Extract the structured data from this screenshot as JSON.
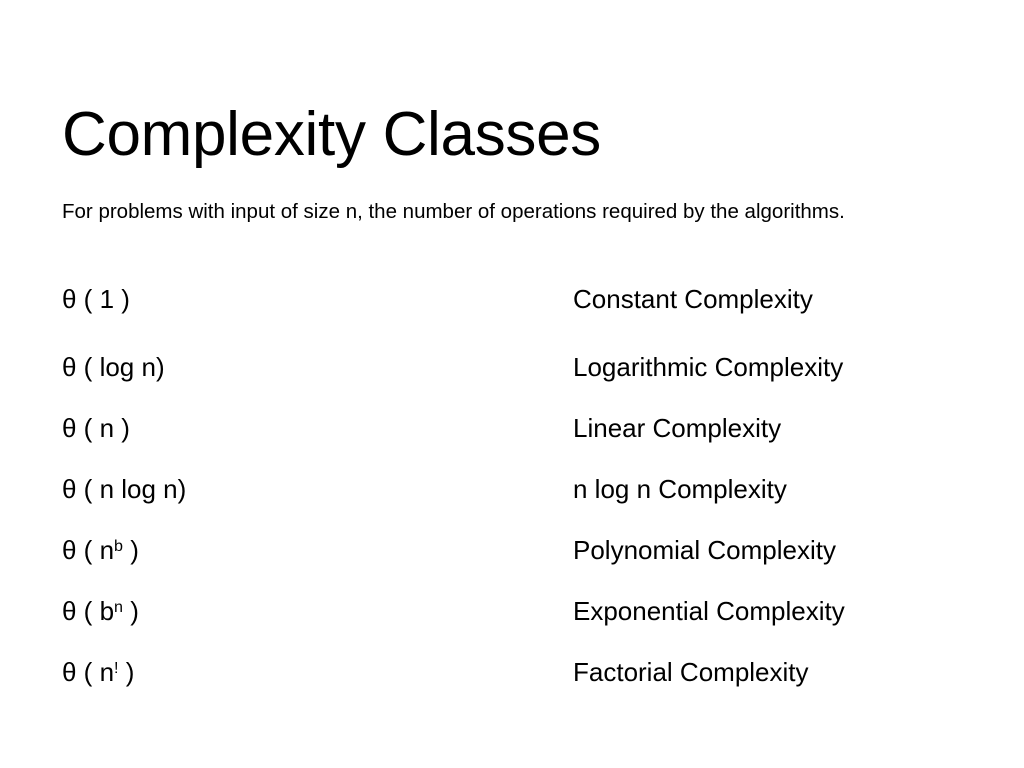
{
  "slide": {
    "title": "Complexity Classes",
    "subtitle": "For problems with input of size n, the number of operations required by the algorithms.",
    "background_color": "#ffffff",
    "text_color": "#000000",
    "theta_symbol": "θ",
    "rows": [
      {
        "notation_prefix": "θ ( 1 )",
        "notation_base": "",
        "notation_sup": "",
        "notation_suffix": "",
        "label": "Constant Complexity"
      },
      {
        "notation_prefix": "θ ( log n)",
        "notation_base": "",
        "notation_sup": "",
        "notation_suffix": "",
        "label": "Logarithmic Complexity"
      },
      {
        "notation_prefix": "θ ( n )",
        "notation_base": "",
        "notation_sup": "",
        "notation_suffix": "",
        "label": "Linear Complexity"
      },
      {
        "notation_prefix": "θ ( n log n)",
        "notation_base": "",
        "notation_sup": "",
        "notation_suffix": "",
        "label": "n log n Complexity"
      },
      {
        "notation_prefix": "θ ( ",
        "notation_base": "n",
        "notation_sup": "b",
        "notation_suffix": " )",
        "label": "Polynomial Complexity"
      },
      {
        "notation_prefix": "θ ( ",
        "notation_base": "b",
        "notation_sup": "n",
        "notation_suffix": " )",
        "label": "Exponential Complexity"
      },
      {
        "notation_prefix": "θ ( ",
        "notation_base": "n",
        "notation_sup": "!",
        "notation_suffix": " )",
        "label": "Factorial Complexity"
      }
    ]
  }
}
